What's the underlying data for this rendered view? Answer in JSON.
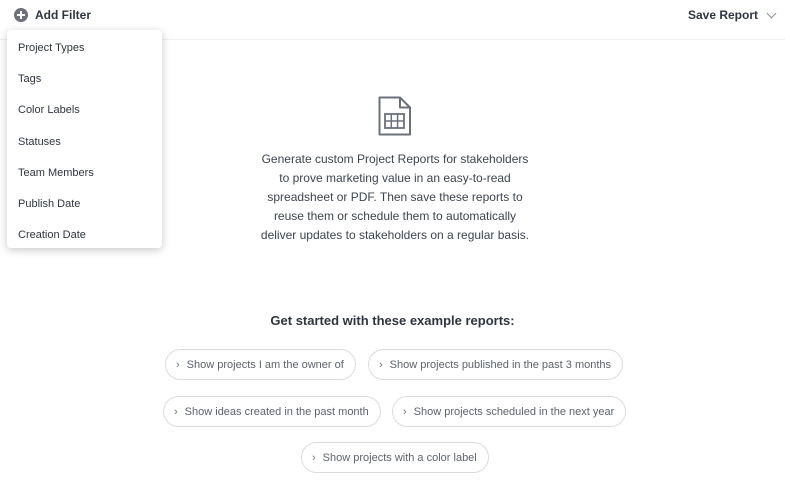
{
  "header": {
    "add_filter_label": "Add Filter",
    "save_report_label": "Save Report"
  },
  "filter_menu": {
    "items": [
      {
        "label": "Project Types"
      },
      {
        "label": "Tags"
      },
      {
        "label": "Color Labels"
      },
      {
        "label": "Statuses"
      },
      {
        "label": "Team Members"
      },
      {
        "label": "Publish Date"
      },
      {
        "label": "Creation Date"
      }
    ]
  },
  "main": {
    "icon": "spreadsheet-icon",
    "description_lines": [
      "Generate custom Project Reports for stakeholders",
      "to prove marketing value in an easy-to-read",
      "spreadsheet or PDF. Then save these reports to",
      "reuse them or schedule them to automatically",
      "deliver updates to stakeholders on a regular basis."
    ],
    "examples_heading": "Get started with these example reports:",
    "examples": [
      {
        "label": "Show projects I am the owner of"
      },
      {
        "label": "Show projects published in the past 3 months"
      },
      {
        "label": "Show ideas created in the past month"
      },
      {
        "label": "Show projects scheduled in the next year"
      },
      {
        "label": "Show projects with a color label"
      }
    ]
  },
  "colors": {
    "text_dark": "#2f3540",
    "text_body": "#3d4451",
    "chip_border": "#d9dcdf",
    "icon_gray": "#6b717b"
  }
}
